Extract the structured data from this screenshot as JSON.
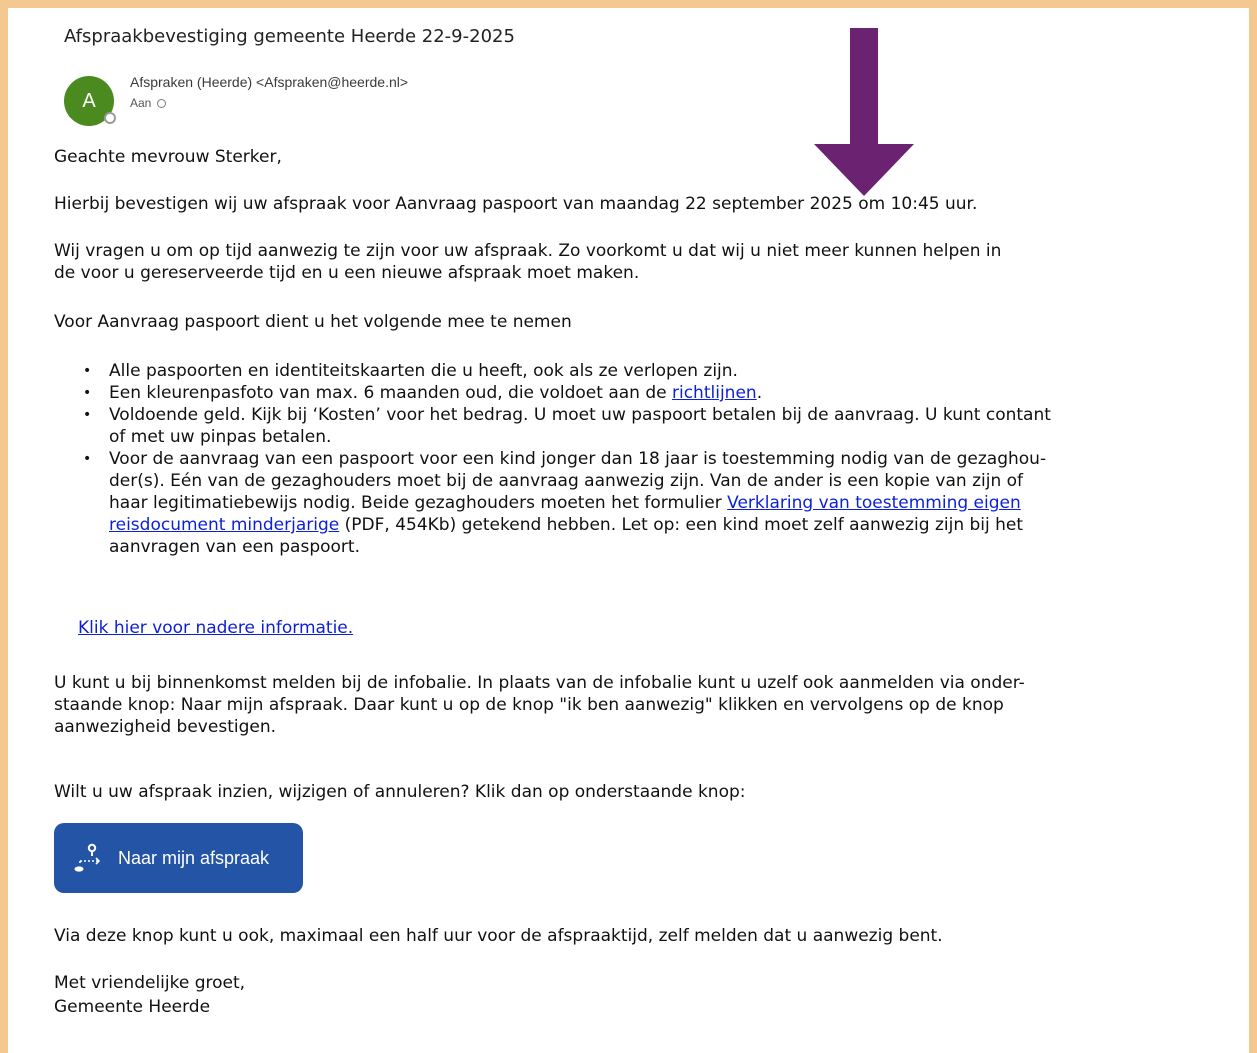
{
  "email": {
    "subject": "Afspraakbevestiging gemeente Heerde 22-9-2025",
    "avatar_initial": "A",
    "sender": "Afspraken (Heerde) <Afspraken@heerde.nl>",
    "to_label": "Aan"
  },
  "body": {
    "greeting": "Geachte mevrouw Sterker,",
    "confirmation": "Hierbij bevestigen wij uw afspraak voor Aanvraag paspoort van maandag 22 september 2025 om 10:45 uur.",
    "on_time_line1": "Wij vragen u om op tijd aanwezig te zijn voor uw afspraak. Zo voorkomt u dat wij u niet meer kunnen helpen in",
    "on_time_line2": "de voor u gereserveerde tijd en u een nieuwe afspraak moet maken.",
    "bring_intro": "Voor Aanvraag paspoort dient u het volgende mee te nemen",
    "bullets": {
      "b1": "Alle paspoorten en identiteitskaarten die u heeft, ook als ze verlopen zijn.",
      "b2_before": "Een kleurenpasfoto van max. 6 maanden oud, die voldoet aan de ",
      "b2_link": "richtlijnen",
      "b2_after": ".",
      "b3_line1": "Voldoende geld. Kijk bij ‘Kosten’ voor het bedrag. U moet uw paspoort betalen bij de aanvraag. U kunt contant",
      "b3_line2": "of met uw pinpas betalen.",
      "b4_line1": "Voor de aanvraag van een paspoort voor een kind jonger dan 18 jaar is toestemming nodig van de gezaghou-",
      "b4_line2": "der(s). Eén van de gezaghouders moet bij de aanvraag aanwezig zijn. Van de ander is een kopie van zijn of",
      "b4_line3_before": "haar legitimatiebewijs nodig. Beide gezaghouders moeten het formulier ",
      "b4_link_line1": "Verklaring van toestemming eigen",
      "b4_link_line2": "reisdocument minderjarige",
      "b4_line4_after": " (PDF, 454Kb) getekend hebben. Let op: een kind moet zelf aanwezig zijn bij het",
      "b4_line5": "aanvragen van een paspoort."
    },
    "more_info_link": "Klik hier voor nadere informatie.",
    "checkin_line1": "U kunt u bij binnenkomst melden bij de infobalie. In plaats van de infobalie kunt u uzelf ook aanmelden via onder-",
    "checkin_line2": "staande knop: Naar mijn afspraak. Daar kunt u op de knop \"ik ben aanwezig\" klikken en vervolgens op de knop",
    "checkin_line3": "aanwezigheid bevestigen.",
    "change_prompt": "Wilt u uw afspraak inzien, wijzigen of annuleren? Klik dan op onderstaande knop:",
    "button_label": "Naar mijn afspraak",
    "button_note": "Via deze knop kunt u ook, maximaal een half uur voor de afspraaktijd, zelf melden dat u aanwezig bent.",
    "closing": "Met vriendelijke groet,",
    "signature": "Gemeente Heerde"
  },
  "colors": {
    "border": "#f3c991",
    "avatar": "#4b8a1f",
    "arrow": "#6b2270",
    "button": "#2454a6",
    "link": "#0b1fd8"
  }
}
